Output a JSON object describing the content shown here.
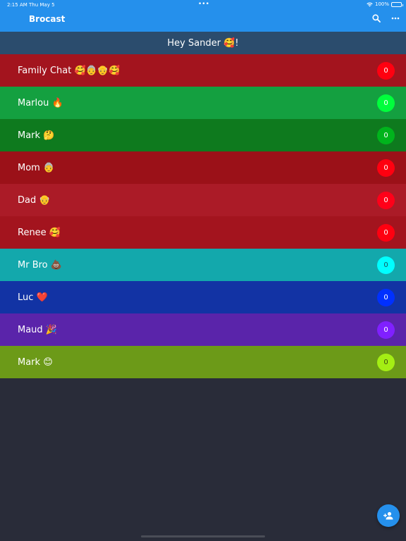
{
  "status_bar": {
    "time": "2:15 AM",
    "date": "Thu May 5",
    "battery": "100%"
  },
  "header": {
    "title": "Brocast",
    "search_icon": "search-icon",
    "more_icon": "more-horizontal-icon",
    "background": "#2590ec"
  },
  "greeting": {
    "text": "Hey Sander 🥰!",
    "background": "#2b4c6d"
  },
  "chats": [
    {
      "name": "Family Chat 🥰👵👴🥰",
      "unread": "0",
      "row_color": "#a3141e",
      "badge_color": "#ff0010",
      "badge_text_color": "#ffffff"
    },
    {
      "name": "Marlou 🔥",
      "unread": "0",
      "row_color": "#14a040",
      "badge_color": "#00ff3c",
      "badge_text_color": "#ffffff"
    },
    {
      "name": "Mark 🤔",
      "unread": "0",
      "row_color": "#0e7a1e",
      "badge_color": "#00b41c",
      "badge_text_color": "#ffffff"
    },
    {
      "name": "Mom 👵",
      "unread": "0",
      "row_color": "#9b1118",
      "badge_color": "#ff0010",
      "badge_text_color": "#ffffff"
    },
    {
      "name": "Dad 👴",
      "unread": "0",
      "row_color": "#ab1b27",
      "badge_color": "#ff0019",
      "badge_text_color": "#ffffff"
    },
    {
      "name": "Renee 🥰",
      "unread": "0",
      "row_color": "#a3141e",
      "badge_color": "#ff0010",
      "badge_text_color": "#ffffff"
    },
    {
      "name": "Mr Bro 💩",
      "unread": "0",
      "row_color": "#13a8ac",
      "badge_color": "#00ffff",
      "badge_text_color": "#1a5560"
    },
    {
      "name": "Luc ❤️",
      "unread": "0",
      "row_color": "#1233a4",
      "badge_color": "#0030ff",
      "badge_text_color": "#ffffff"
    },
    {
      "name": "Maud 🎉",
      "unread": "0",
      "row_color": "#5a24aa",
      "badge_color": "#8020ff",
      "badge_text_color": "#ffffff"
    },
    {
      "name": "Mark 😊",
      "unread": "0",
      "row_color": "#6c9a18",
      "badge_color": "#a4ee14",
      "badge_text_color": "#3a4a10"
    }
  ],
  "fab": {
    "icon": "add-contact-icon",
    "background": "#2590ec"
  },
  "page_background": "#292c39"
}
